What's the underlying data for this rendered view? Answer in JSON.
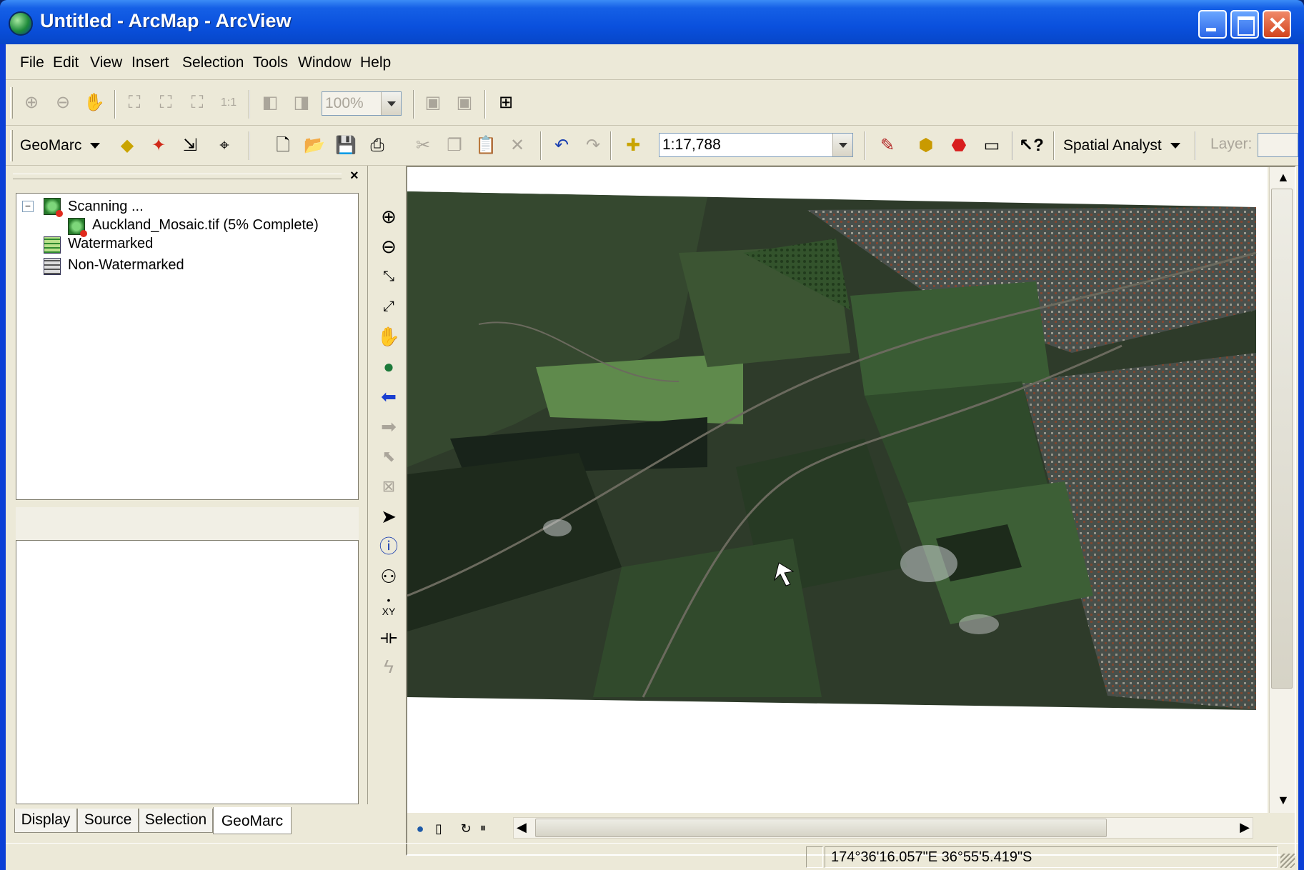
{
  "window": {
    "title": "Untitled - ArcMap - ArcView"
  },
  "menu": [
    "File",
    "Edit",
    "View",
    "Insert",
    "Selection",
    "Tools",
    "Window",
    "Help"
  ],
  "toolbar1": {
    "zoom_value": "100%"
  },
  "toolbar2": {
    "geomarc_label": "GeoMarc",
    "scale_value": "1:17,788",
    "spatial_analyst_label": "Spatial Analyst",
    "layer_label": "Layer:"
  },
  "toc": {
    "items": [
      {
        "label": "Scanning ..."
      },
      {
        "label": "Auckland_Mosaic.tif (5% Complete)"
      },
      {
        "label": "Watermarked"
      },
      {
        "label": "Non-Watermarked"
      }
    ],
    "tabs": [
      "Display",
      "Source",
      "Selection",
      "GeoMarc"
    ],
    "active_tab": "GeoMarc"
  },
  "status": {
    "coordinates": "174°36'16.057\"E  36°55'5.419\"S"
  },
  "colors": {
    "title_bar": "#0a50dd",
    "chrome": "#ece9d8"
  }
}
